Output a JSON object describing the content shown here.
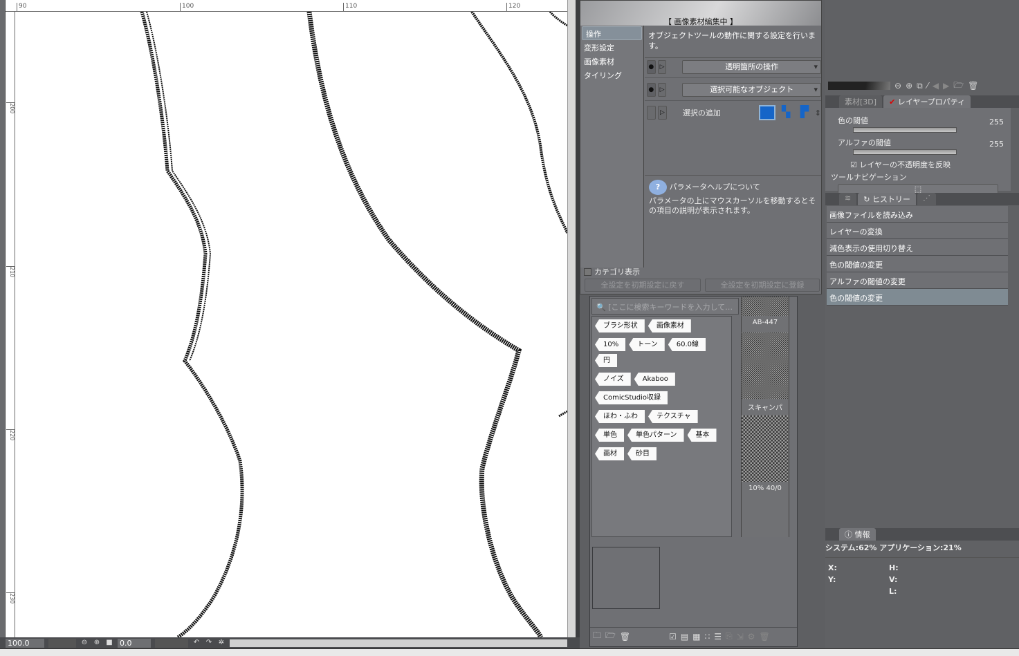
{
  "ruler": {
    "top": [
      "90",
      "100",
      "110",
      "120"
    ],
    "left": [
      "200",
      "210",
      "220",
      "230"
    ]
  },
  "status": {
    "zoom": "100.0",
    "angle": "0.0"
  },
  "subwindow": {
    "title": "【 画像素材編集中 】",
    "categories": [
      "操作",
      "変形設定",
      "画像素材",
      "タイリング"
    ],
    "description": "オブジェクトツールの動作に関する設定を行います。",
    "params": [
      {
        "label": "透明箇所の操作"
      },
      {
        "label": "選択可能なオブジェクト"
      },
      {
        "label": "選択の追加"
      }
    ],
    "help_title": "パラメータヘルプについて",
    "help_text": "パラメータの上にマウスカーソルを移動するとその項目の説明が表示されます。",
    "category_toggle": "カテゴリ表示",
    "reset_button": "全設定を初期設定に戻す",
    "register_button": "全設定を初期設定に登録"
  },
  "materials": {
    "search_placeholder": "[ここに検索キーワードを入力して…",
    "tags": [
      "ブラシ形状",
      "画像素材",
      "10%",
      "トーン",
      "60.0線",
      "円",
      "ノイズ",
      "Akaboo",
      "ComicStudio収録",
      "ほわ・ふわ",
      "テクスチャ",
      "単色",
      "単色パターン",
      "基本",
      "画材",
      "砂目"
    ],
    "thumbs": [
      "AB-447",
      "スキャンパ",
      "10% 40/0"
    ]
  },
  "right": {
    "tabs": [
      "素材[3D]",
      "レイヤープロパティ"
    ],
    "color_threshold_label": "色の閾値",
    "color_threshold": "255",
    "alpha_threshold_label": "アルファの閾値",
    "alpha_threshold": "255",
    "reflect_opacity": "レイヤーの不透明度を反映",
    "tool_nav": "ツールナビゲーション",
    "history_tab": "ヒストリー",
    "history": [
      "画像ファイルを読み込み",
      "レイヤーの変換",
      "減色表示の使用切り替え",
      "色の閾値の変更",
      "アルファの閾値の変更",
      "色の閾値の変更"
    ],
    "info_tab": "情報",
    "system": "システム:62% アプリケーション:21%",
    "coords": [
      "X:",
      "H:",
      "Y:",
      "V:",
      "",
      "L:"
    ]
  }
}
